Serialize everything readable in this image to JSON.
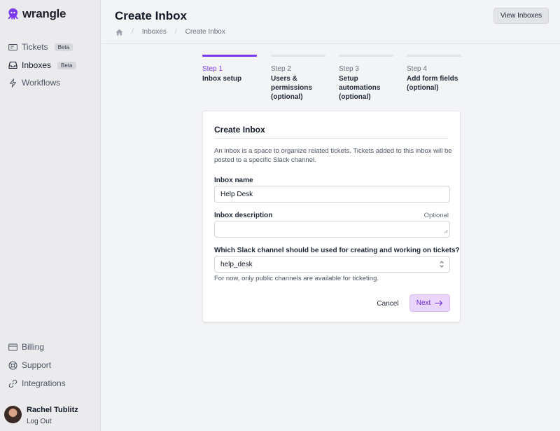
{
  "app": {
    "name": "wrangle",
    "brand_color": "#7c3aed"
  },
  "sidebar": {
    "items": [
      {
        "label": "Tickets",
        "badge": "Beta",
        "icon": "ticket-icon"
      },
      {
        "label": "Inboxes",
        "badge": "Beta",
        "icon": "inbox-icon",
        "active": true
      },
      {
        "label": "Workflows",
        "icon": "bolt-icon"
      }
    ],
    "bottom_items": [
      {
        "label": "Billing",
        "icon": "credit-card-icon"
      },
      {
        "label": "Support",
        "icon": "lifebuoy-icon"
      },
      {
        "label": "Integrations",
        "icon": "link-icon"
      }
    ],
    "user": {
      "name": "Rachel Tublitz",
      "logout_label": "Log Out"
    }
  },
  "header": {
    "title": "Create Inbox",
    "breadcrumb": [
      "Inboxes",
      "Create Inbox"
    ],
    "view_inboxes_label": "View Inboxes"
  },
  "steps": [
    {
      "number": "Step 1",
      "name": "Inbox setup",
      "active": true
    },
    {
      "number": "Step 2",
      "name": "Users & permissions (optional)"
    },
    {
      "number": "Step 3",
      "name": "Setup automations (optional)"
    },
    {
      "number": "Step 4",
      "name": "Add form fields (optional)"
    }
  ],
  "form": {
    "title": "Create Inbox",
    "description": "An inbox is a space to organize related tickets. Tickets added to this inbox will be posted to a specific Slack channel.",
    "name_label": "Inbox name",
    "name_value": "Help Desk",
    "description_label": "Inbox description",
    "description_optional": "Optional",
    "description_value": "",
    "channel_label": "Which Slack channel should be used for creating and working on tickets?",
    "channel_value": "help_desk",
    "channel_hint": "For now, only public channels are available for ticketing.",
    "cancel_label": "Cancel",
    "next_label": "Next"
  }
}
